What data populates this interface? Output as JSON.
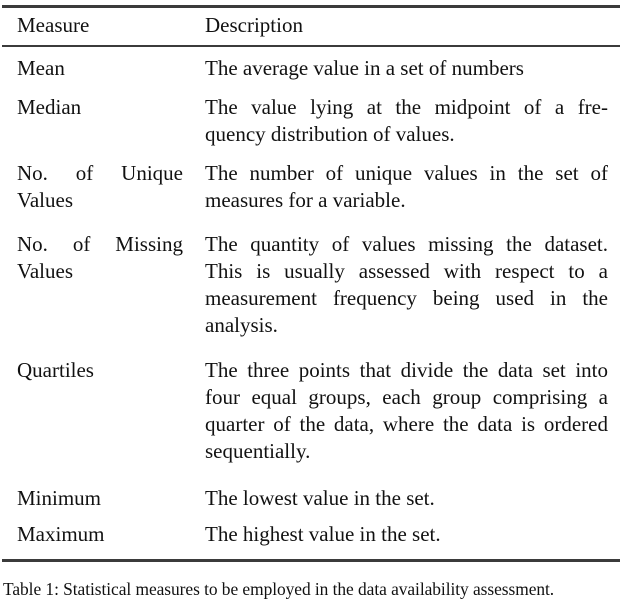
{
  "document": {
    "type": "table-figure",
    "background_color": "#ffffff",
    "text_color": "#111111",
    "rule_color": "#3b3b3b"
  },
  "table": {
    "header": {
      "measure": "Measure",
      "description": "Description"
    },
    "rows": [
      {
        "measure_lines": [
          "Mean"
        ],
        "description_lines": [
          "The average value in a set of numbers"
        ],
        "measure": "Mean",
        "description": "The average value in a set of numbers"
      },
      {
        "measure_lines": [
          "Median"
        ],
        "description_lines": [
          "The value lying at the midpoint of a fre-",
          "quency distribution of values."
        ],
        "measure": "Median",
        "description": "The value lying at the midpoint of a frequency distribution of values."
      },
      {
        "measure_lines": [
          "No. of Unique",
          "Values"
        ],
        "description_lines": [
          "The number of unique values in the set of",
          "measures for a variable."
        ],
        "measure": "No. of Unique Values",
        "description": "The number of unique values in the set of measures for a variable."
      },
      {
        "measure_lines": [
          "No. of Missing",
          "Values"
        ],
        "description_lines": [
          "The quantity of values missing the dataset.",
          "This is usually assessed with respect to a",
          "measurement frequency being used in the",
          "analysis."
        ],
        "measure": "No. of Missing Values",
        "description": "The quantity of values missing the dataset. This is usually assessed with respect to a measurement frequency being used in the analysis."
      },
      {
        "measure_lines": [
          "Quartiles"
        ],
        "description_lines": [
          "The three points that divide the data set into",
          "four equal groups, each group comprising a",
          "quarter of the data, where the data is ordered",
          "sequentially."
        ],
        "measure": "Quartiles",
        "description": "The three points that divide the data set into four equal groups, each group comprising a quarter of the data, where the data is ordered sequentially."
      },
      {
        "measure_lines": [
          "Minimum"
        ],
        "description_lines": [
          "The lowest value in the set."
        ],
        "measure": "Minimum",
        "description": "The lowest value in the set."
      },
      {
        "measure_lines": [
          "Maximum"
        ],
        "description_lines": [
          "The highest value in the set."
        ],
        "measure": "Maximum",
        "description": "The highest value in the set."
      }
    ]
  },
  "caption": {
    "text": "Table 1: Statistical measures to be employed in the data availability assessment."
  }
}
